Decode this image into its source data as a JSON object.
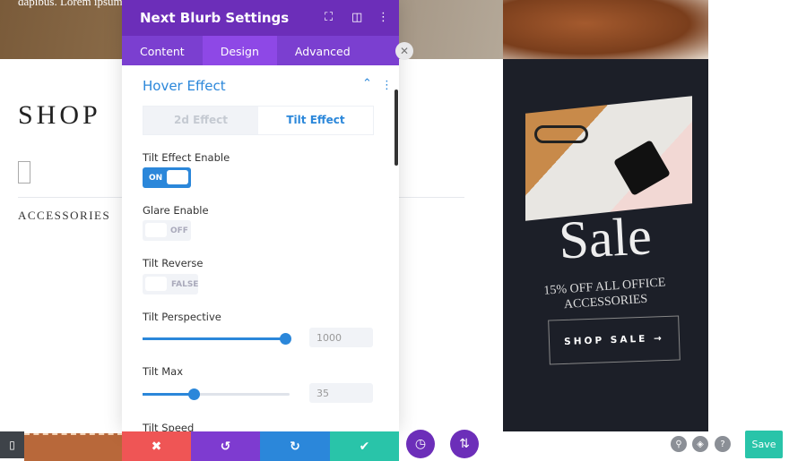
{
  "page": {
    "banner_text": "dapibus. Lorem ipsum",
    "shop_title": "SHOP",
    "category": "ACCESSORIES"
  },
  "promo": {
    "title": "Sale",
    "subtitle": "15% OFF ALL OFFICE ACCESSORIES",
    "button": "SHOP SALE →"
  },
  "modal": {
    "title": "Next Blurb Settings",
    "tabs": [
      {
        "label": "Content"
      },
      {
        "label": "Design"
      },
      {
        "label": "Advanced"
      }
    ],
    "active_tab": "Design",
    "section": "Hover Effect",
    "subtabs": [
      {
        "label": "2d Effect"
      },
      {
        "label": "Tilt Effect"
      }
    ],
    "active_subtab": "Tilt Effect",
    "tilt_enable": {
      "label": "Tilt Effect Enable",
      "state": "ON"
    },
    "glare_enable": {
      "label": "Glare Enable",
      "state": "OFF"
    },
    "tilt_reverse": {
      "label": "Tilt Reverse",
      "state": "FALSE"
    },
    "tilt_perspective": {
      "label": "Tilt Perspective",
      "value": "1000",
      "fraction": 0.97
    },
    "tilt_max": {
      "label": "Tilt Max",
      "value": "35",
      "fraction": 0.35
    },
    "tilt_speed": {
      "label": "Tilt Speed"
    }
  },
  "footer": {
    "save": "Save"
  },
  "colors": {
    "purple": "#6c2eb9",
    "blue": "#2b87da",
    "red": "#ef5555",
    "green": "#29c4a9",
    "dark": "#1c1f28"
  }
}
